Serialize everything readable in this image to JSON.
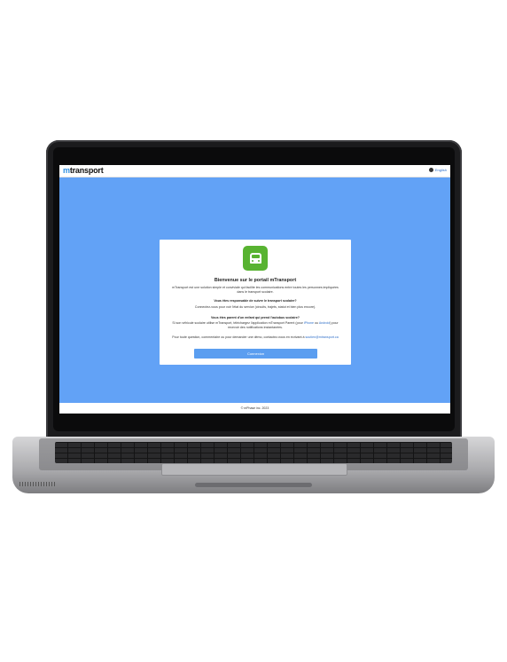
{
  "header": {
    "logo_prefix": "m",
    "logo_rest": "transport",
    "language_label": "English"
  },
  "card": {
    "title": "Bienvenue sur le portail mTransport",
    "intro": "mTransport est une solution simple et conviviale qui facilite les communications entre toutes les personnes impliquées dans le transport scolaire.",
    "q1_title": "Vous êtes responsable de suivre le transport scolaire?",
    "q1_text": "Connectez-vous pour voir l'état du service (circuits, trajets, statut et bien plus encore).",
    "q2_title": "Vous êtes parent d'un enfant qui prend l'autobus scolaire?",
    "q2_text_1": "Si son véhicule scolaire utilise mTransport, téléchargez l'application mTransport Parent (pour",
    "q2_link_iphone": "iPhone",
    "q2_text_2": "ou",
    "q2_link_android": "Android",
    "q2_text_3": ") pour recevoir des notifications instantanées.",
    "contact_text": "Pour toute question, commentaire ou pour demander une démo, contactez-nous en écrivant à",
    "contact_email": "soutien@mtransport.ca",
    "login_button": "Connexion"
  },
  "footer": {
    "copyright": "© mPhase inc. 2023"
  }
}
